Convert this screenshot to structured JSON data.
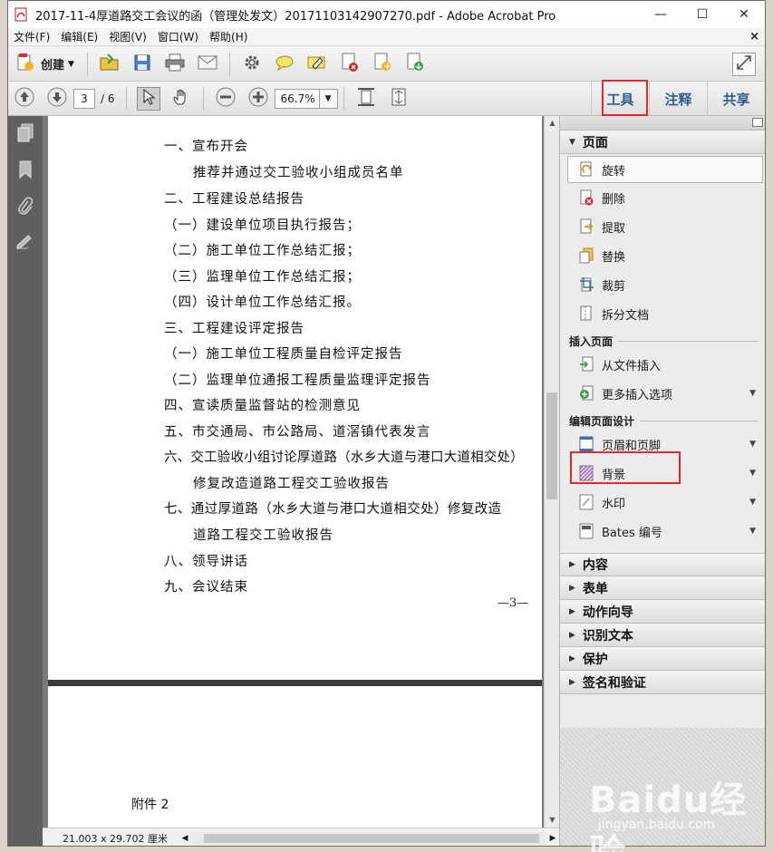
{
  "window": {
    "title": "2017-11-4厚道路交工会议的函（管理处发文）20171103142907270.pdf - Adobe Acrobat Pro",
    "minimize": "—",
    "maximize": "☐",
    "close": "✕"
  },
  "menu": {
    "items": [
      "文件(F)",
      "编辑(E)",
      "视图(V)",
      "窗口(W)",
      "帮助(H)"
    ],
    "close_doc": "×"
  },
  "toolbar": {
    "create_label": "创建"
  },
  "nav": {
    "current_page": "3",
    "total_pages": "/ 6",
    "zoom": "66.7%"
  },
  "tabs": {
    "tools": "工具",
    "comment": "注释",
    "share": "共享"
  },
  "document": {
    "lines": [
      "一、宣布开会",
      "推荐并通过交工验收小组成员名单",
      "二、工程建设总结报告",
      "（一）建设单位项目执行报告；",
      "（二）施工单位工作总结汇报；",
      "（三）监理单位工作总结汇报；",
      "（四）设计单位工作总结汇报。",
      "三、工程建设评定报告",
      "（一）施工单位工程质量自检评定报告",
      "（二）监理单位通报工程质量监理评定报告",
      "四、宣读质量监督站的检测意见",
      "五、市交通局、市公路局、道滘镇代表发言",
      "六、交工验收小组讨论厚道路（水乡大道与港口大道相交处）",
      "修复改造道路工程交工验收报告",
      "七、通过厚道路（水乡大道与港口大道相交处）修复改造",
      "道路工程交工验收报告",
      "八、领导讲话",
      "九、会议结束"
    ],
    "page_number": "—3—",
    "next_page_text": "附件 2"
  },
  "status": {
    "dimensions": "21.003 x 29.702 厘米"
  },
  "panel": {
    "pages_title": "页面",
    "pages_items": [
      "旋转",
      "删除",
      "提取",
      "替换",
      "裁剪",
      "拆分文档"
    ],
    "insert_title": "插入页面",
    "insert_items": [
      "从文件插入",
      "更多插入选项"
    ],
    "design_title": "编辑页面设计",
    "design_items": [
      "页眉和页脚",
      "背景",
      "水印",
      "Bates 编号"
    ],
    "collapsed": [
      "内容",
      "表单",
      "动作向导",
      "识别文本",
      "保护",
      "签名和验证"
    ]
  },
  "watermark": {
    "brand": "Baidu经验",
    "url": "jingyan.baidu.com"
  },
  "colors": {
    "highlight": "#e8262c",
    "tab_blue": "#2c5e91",
    "nav_dark": "#5f5f5f"
  }
}
